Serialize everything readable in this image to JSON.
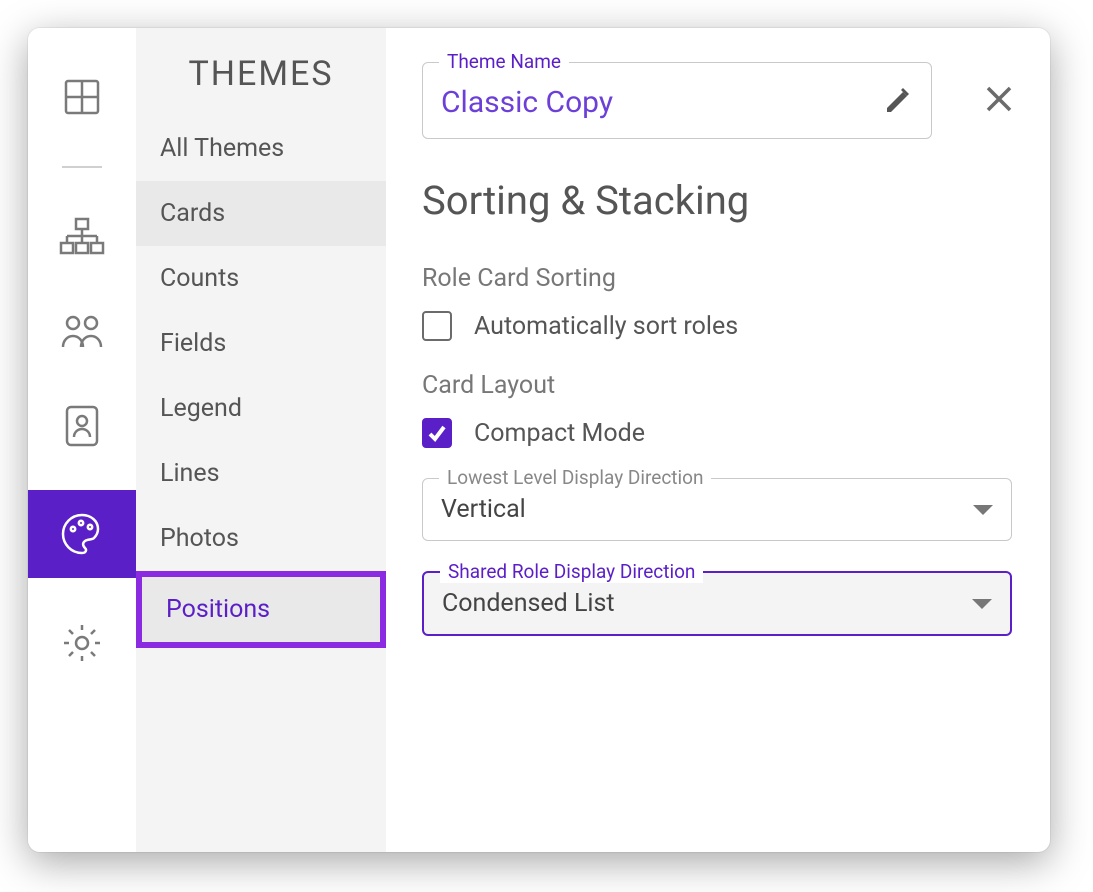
{
  "sidelist": {
    "title": "THEMES",
    "items": [
      {
        "label": "All Themes"
      },
      {
        "label": "Cards"
      },
      {
        "label": "Counts"
      },
      {
        "label": "Fields"
      },
      {
        "label": "Legend"
      },
      {
        "label": "Lines"
      },
      {
        "label": "Photos"
      },
      {
        "label": "Positions"
      }
    ]
  },
  "theme_name": {
    "label": "Theme Name",
    "value": "Classic Copy"
  },
  "section_title": "Sorting & Stacking",
  "role_sort": {
    "label": "Role Card Sorting",
    "checkbox_label": "Automatically sort roles",
    "checked": false
  },
  "card_layout": {
    "label": "Card Layout",
    "checkbox_label": "Compact Mode",
    "checked": true
  },
  "lowest_level": {
    "label": "Lowest Level Display Direction",
    "value": "Vertical"
  },
  "shared_role": {
    "label": "Shared Role Display Direction",
    "value": "Condensed List"
  }
}
